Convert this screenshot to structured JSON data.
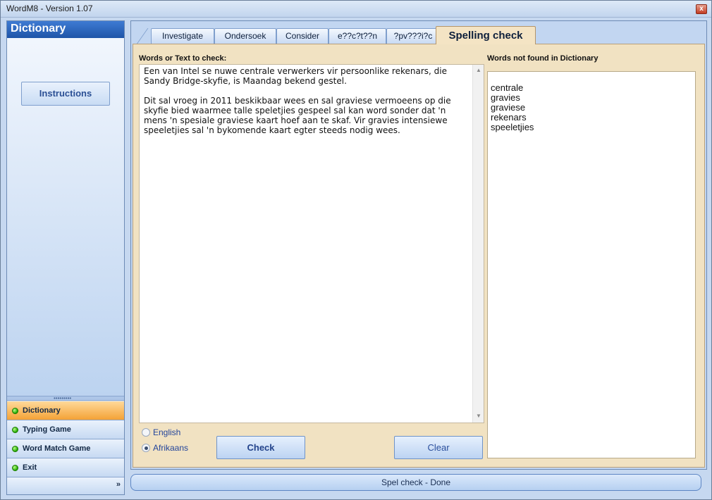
{
  "window": {
    "title": "WordM8 - Version 1.07",
    "close_glyph": "x"
  },
  "sidebar": {
    "header": "Dictionary",
    "instructions_label": "Instructions",
    "splitter_glyph": "•••••••••",
    "items": [
      {
        "label": "Dictionary",
        "active": true
      },
      {
        "label": "Typing Game"
      },
      {
        "label": "Word Match Game"
      },
      {
        "label": "Exit"
      }
    ],
    "more_glyph": "»"
  },
  "tabs": [
    {
      "label": "Investigate"
    },
    {
      "label": "Ondersoek"
    },
    {
      "label": "Consider"
    },
    {
      "label": "e??c?t??n"
    },
    {
      "label": "?pv???i?c"
    },
    {
      "label": "Spelling check",
      "active": true
    }
  ],
  "spell": {
    "input_label": "Words or Text to check:",
    "input_text": "Een van Intel se nuwe centrale verwerkers vir persoonlike rekenars, die Sandy Bridge-skyfie, is Maandag bekend gestel.\n\nDit sal vroeg in 2011 beskikbaar wees en sal graviese vermoeens op die skyfie bied waarmee talle speletjies gespeel sal kan word sonder dat 'n mens 'n spesiale graviese kaart hoef aan te skaf. Vir gravies intensiewe speeletjies sal 'n bykomende kaart egter steeds nodig wees.",
    "notfound_label": "Words not found in Dictionary",
    "notfound_words": [
      "centrale",
      "gravies",
      "graviese",
      "rekenars",
      "speeletjies"
    ],
    "languages": [
      {
        "label": "English",
        "selected": false
      },
      {
        "label": "Afrikaans",
        "selected": true
      }
    ],
    "check_label": "Check",
    "clear_label": "Clear",
    "scroll_up_glyph": "▲",
    "scroll_down_glyph": "▼"
  },
  "status": {
    "text": "Spel check - Done"
  }
}
